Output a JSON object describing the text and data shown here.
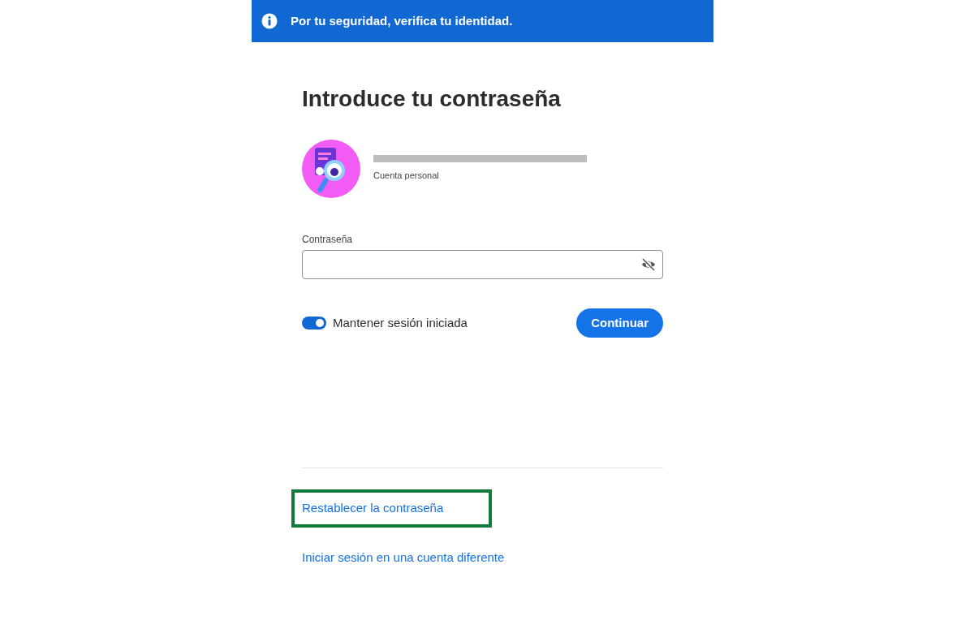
{
  "banner": {
    "text": "Por tu seguridad, verifica tu identidad."
  },
  "heading": "Introduce tu contraseña",
  "account": {
    "email_redacted": true,
    "type": "Cuenta personal"
  },
  "password": {
    "label": "Contraseña",
    "visible": false
  },
  "keep_signed_in": {
    "label": "Mantener sesión iniciada",
    "on": true
  },
  "continue_button": "Continuar",
  "links": [
    {
      "text": "Restablecer la contraseña",
      "highlighted": true
    },
    {
      "text": "Iniciar sesión en una cuenta diferente",
      "highlighted": false
    }
  ]
}
